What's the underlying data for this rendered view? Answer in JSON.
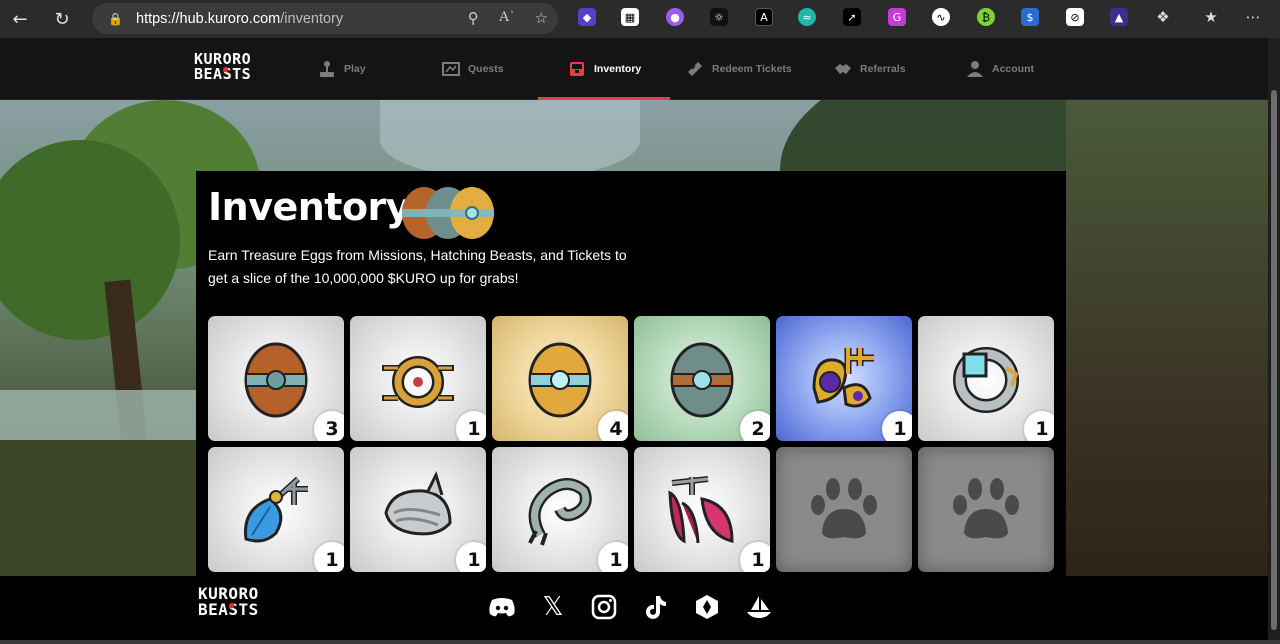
{
  "browser": {
    "url_host": "https://hub.kuroro.com",
    "url_path": "/inventory",
    "back_icon": "back-arrow-icon",
    "refresh_icon": "refresh-icon"
  },
  "site": {
    "logo_line1": "KURORO",
    "logo_line2": "BEASTS",
    "nav": [
      {
        "label": "Play",
        "icon": "joystick-icon"
      },
      {
        "label": "Quests",
        "icon": "map-icon"
      },
      {
        "label": "Inventory",
        "icon": "chest-icon",
        "active": true
      },
      {
        "label": "Redeem Tickets",
        "icon": "ticket-icon"
      },
      {
        "label": "Referrals",
        "icon": "handshake-icon"
      },
      {
        "label": "Account",
        "icon": "user-icon"
      }
    ],
    "accent": "#e5404a"
  },
  "inventory": {
    "title": "Inventory",
    "subtitle": "Earn Treasure Eggs from Missions, Hatching Beasts, and Tickets to get a slice of the 10,000,000 $KURO up for grabs!",
    "items": [
      {
        "name": "bronze-egg",
        "count": "3",
        "bg": "gray"
      },
      {
        "name": "gold-ring",
        "count": "1",
        "bg": "gray"
      },
      {
        "name": "gold-egg",
        "count": "4",
        "bg": "gold"
      },
      {
        "name": "teal-egg",
        "count": "2",
        "bg": "green"
      },
      {
        "name": "purple-gold-ornament",
        "count": "1",
        "bg": "blue"
      },
      {
        "name": "silver-ring",
        "count": "1",
        "bg": "gray"
      },
      {
        "name": "blue-feather-charm",
        "count": "1",
        "bg": "gray"
      },
      {
        "name": "silver-helmet",
        "count": "1",
        "bg": "gray"
      },
      {
        "name": "silver-hook",
        "count": "1",
        "bg": "gray"
      },
      {
        "name": "pink-feather-charm",
        "count": "1",
        "bg": "gray"
      },
      {
        "name": "empty-slot",
        "count": "",
        "bg": "empty"
      },
      {
        "name": "empty-slot",
        "count": "",
        "bg": "empty"
      }
    ]
  },
  "footer": {
    "logo_line1": "KURORO",
    "logo_line2": "BEASTS",
    "social": [
      "discord-icon",
      "x-icon",
      "instagram-icon",
      "tiktok-icon",
      "hex-icon",
      "boat-icon"
    ]
  }
}
